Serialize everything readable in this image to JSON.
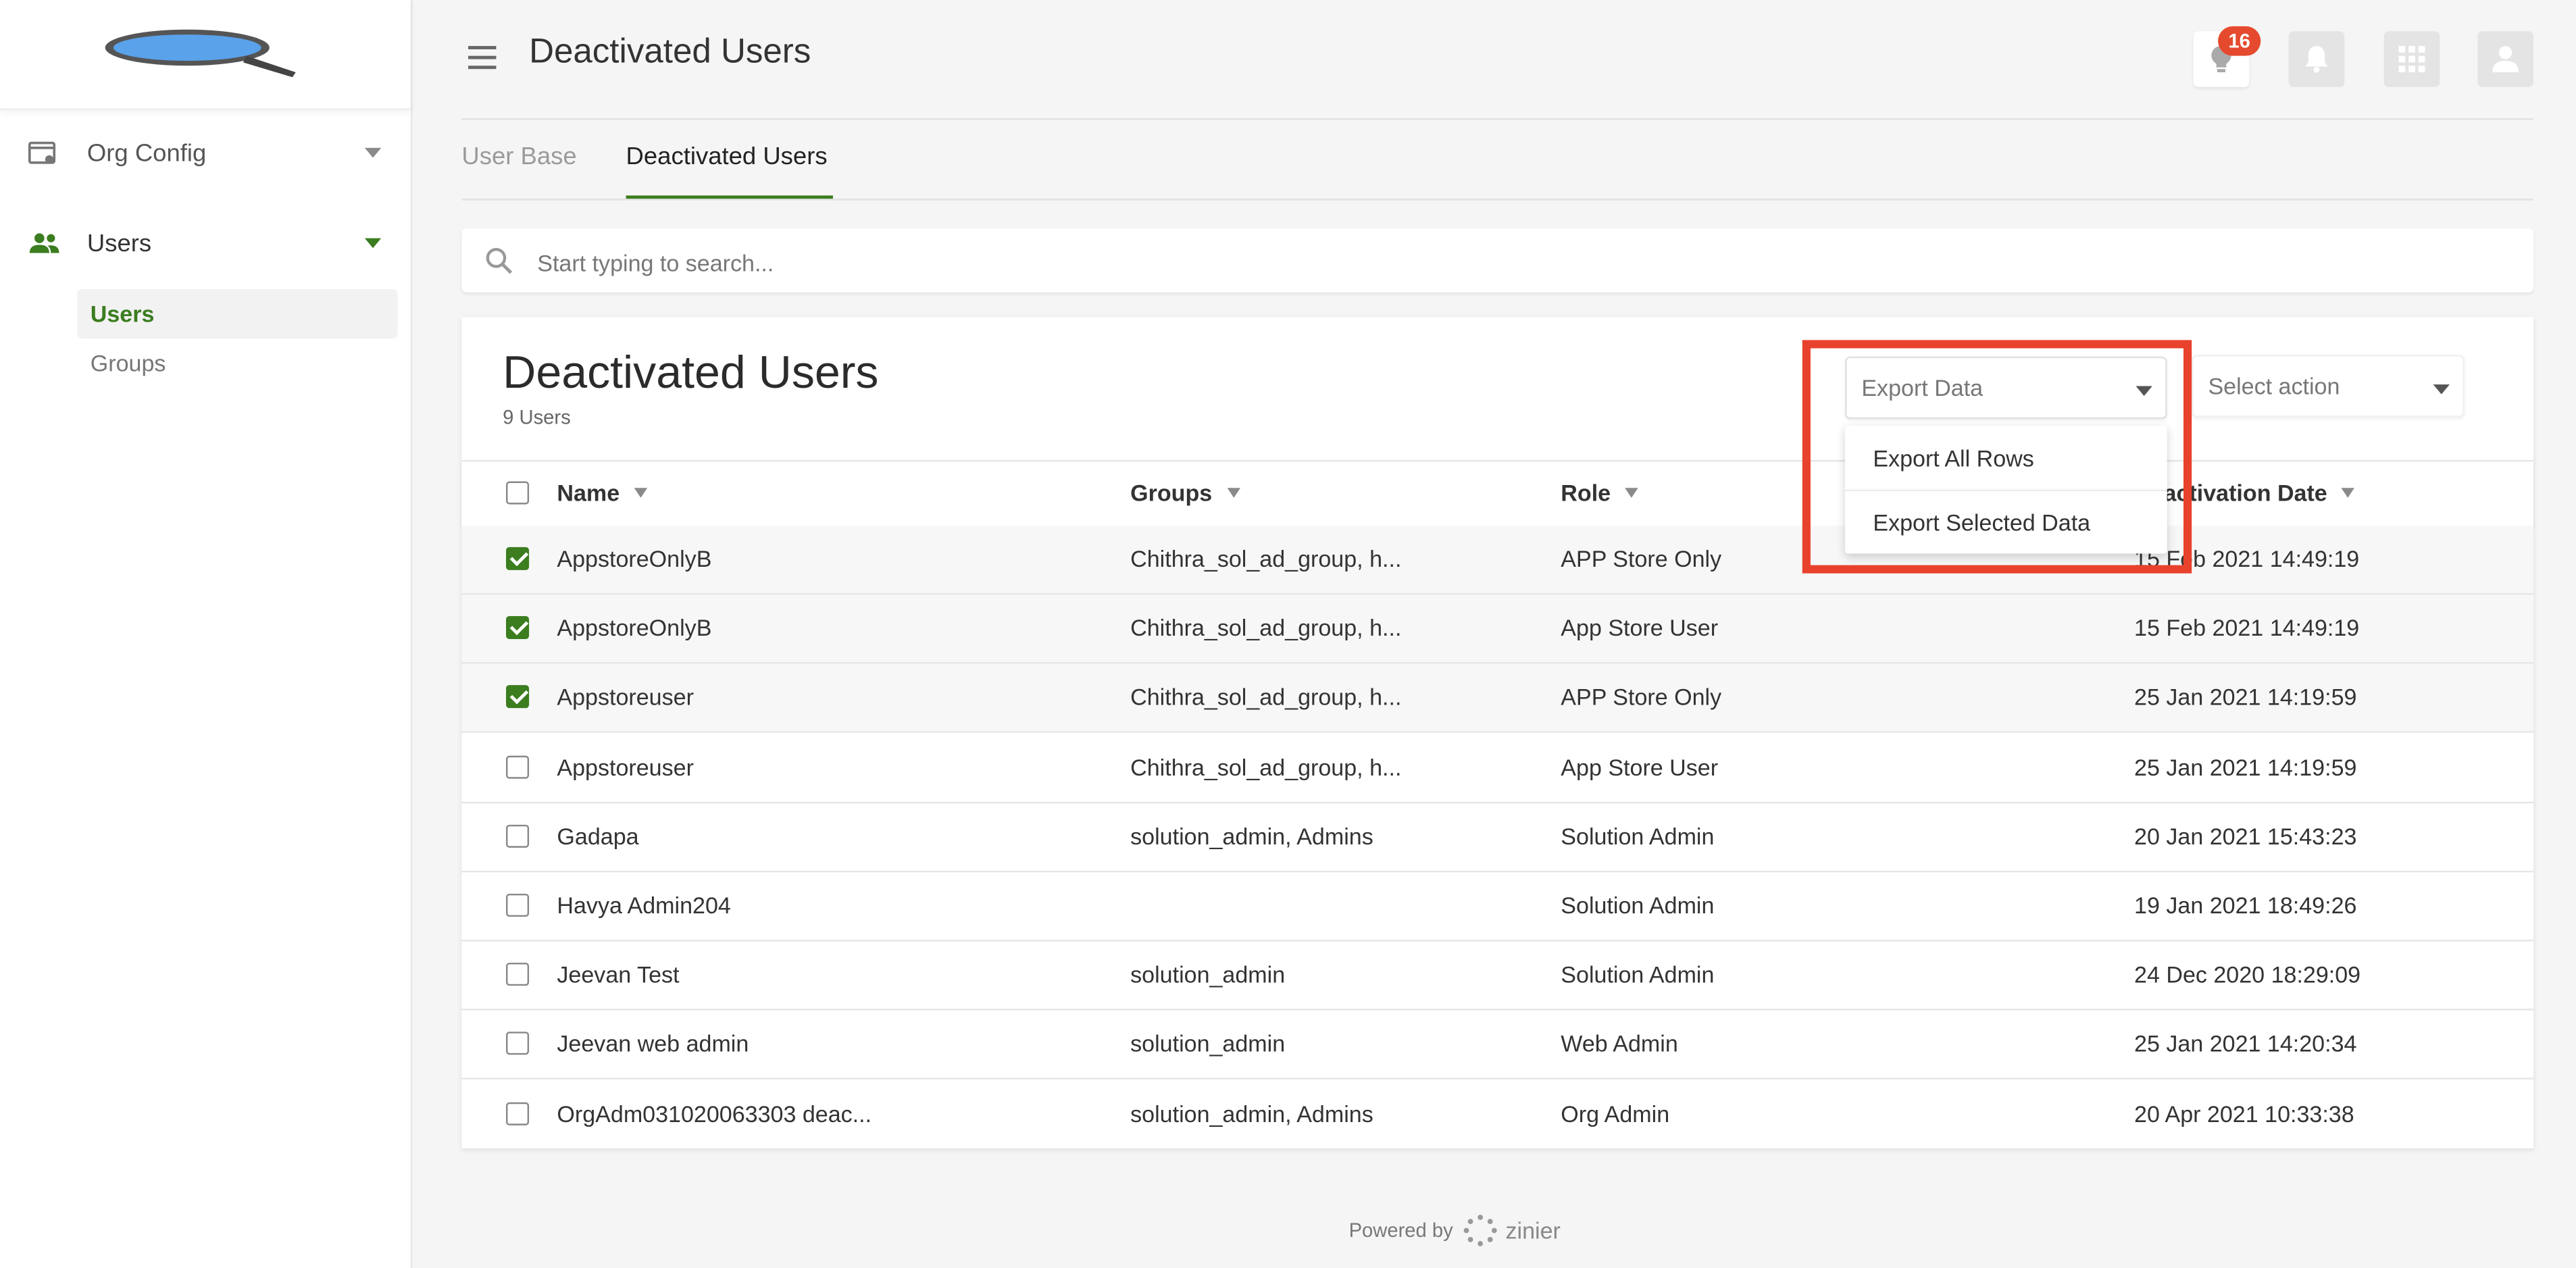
{
  "sidebar": {
    "items": [
      {
        "label": "Org Config"
      },
      {
        "label": "Users"
      }
    ],
    "sub_items": [
      {
        "label": "Users"
      },
      {
        "label": "Groups"
      }
    ]
  },
  "header": {
    "title": "Deactivated Users",
    "notification_count": "16"
  },
  "tabs": [
    {
      "label": "User Base"
    },
    {
      "label": "Deactivated Users"
    }
  ],
  "search": {
    "placeholder": "Start typing to search..."
  },
  "card": {
    "title": "Deactivated Users",
    "count_label": "9 Users",
    "export_dropdown": "Export Data",
    "action_dropdown": "Select action",
    "export_menu": [
      "Export All Rows",
      "Export Selected Data"
    ]
  },
  "table": {
    "columns": [
      "Name",
      "Groups",
      "Role",
      "Deactivation Date"
    ],
    "rows": [
      {
        "name": "AppstoreOnlyB",
        "groups": "Chithra_sol_ad_group, h...",
        "role": "APP Store Only",
        "date": "15 Feb 2021 14:49:19",
        "checked": true
      },
      {
        "name": "AppstoreOnlyB",
        "groups": "Chithra_sol_ad_group, h...",
        "role": "App Store User",
        "date": "15 Feb 2021 14:49:19",
        "checked": true
      },
      {
        "name": "Appstoreuser",
        "groups": "Chithra_sol_ad_group, h...",
        "role": "APP Store Only",
        "date": "25 Jan 2021 14:19:59",
        "checked": true
      },
      {
        "name": "Appstoreuser",
        "groups": "Chithra_sol_ad_group, h...",
        "role": "App Store User",
        "date": "25 Jan 2021 14:19:59",
        "checked": false
      },
      {
        "name": "Gadapa",
        "groups": "solution_admin, Admins",
        "role": "Solution Admin",
        "date": "20 Jan 2021 15:43:23",
        "checked": false
      },
      {
        "name": "Havya Admin204",
        "groups": "",
        "role": "Solution Admin",
        "date": "19 Jan 2021 18:49:26",
        "checked": false
      },
      {
        "name": "Jeevan Test",
        "groups": "solution_admin",
        "role": "Solution Admin",
        "date": "24 Dec 2020 18:29:09",
        "checked": false
      },
      {
        "name": "Jeevan web admin",
        "groups": "solution_admin",
        "role": "Web Admin",
        "date": "25 Jan 2021 14:20:34",
        "checked": false
      },
      {
        "name": "OrgAdm031020063303 deac...",
        "groups": "solution_admin, Admins",
        "role": "Org Admin",
        "date": "20 Apr 2021 10:33:38",
        "checked": false
      }
    ]
  },
  "footer": {
    "powered_by": "Powered by",
    "brand": "zinier"
  },
  "colors": {
    "accent": "#3b7d1f",
    "badge": "#e64a2e",
    "highlight": "#e8412c"
  }
}
